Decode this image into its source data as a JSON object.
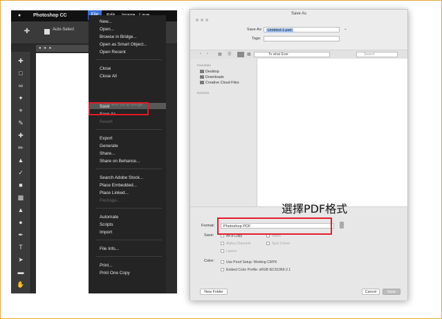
{
  "photoshop": {
    "menubar": {
      "apple": "",
      "app_name": "Photoshop CC",
      "file": "File",
      "edit": "Edit",
      "image": "Image",
      "layer": "Laye"
    },
    "options": {
      "auto_select": "Auto-Select"
    },
    "file_menu": {
      "items": [
        "New...",
        "Open...",
        "Browse in Bridge...",
        "Open as Smart Object...",
        "Open Recent",
        "Close",
        "Close All",
        "Save",
        "Save As...",
        "Revert",
        "Export",
        "Generate",
        "Share...",
        "Share on Behance...",
        "Search Adobe Stock...",
        "Place Embedded...",
        "Place Linked...",
        "Package...",
        "Automate",
        "Scripts",
        "Import",
        "File Info...",
        "Print...",
        "Print One Copy"
      ],
      "ghost": "Close and Go to Bridge..."
    }
  },
  "save_dialog": {
    "title": "Save As",
    "save_as_label": "Save As:",
    "save_as_value": "Untitled-1.psd",
    "tags_label": "Tags:",
    "location": "To what Ever",
    "search_placeholder": "Search",
    "sidebar": {
      "favorites_header": "Favorites",
      "items": [
        "Desktop",
        "Downloads",
        "Creative Cloud Files"
      ],
      "devices_header": "Devices"
    },
    "format_label": "Format:",
    "format_value": "Photoshop PDF",
    "save_label": "Save:",
    "save_options": [
      "As a Copy",
      "Notes",
      "Alpha Channels",
      "Spot Colors",
      "Layers"
    ],
    "color_label": "Color:",
    "color_options": [
      "Use Proof Setup:  Working CMYK",
      "Embed Color Profile:  sRGB IEC61966-2.1"
    ],
    "new_folder": "New Folder",
    "cancel": "Cancel",
    "save": "Save"
  },
  "annotation": {
    "text": "選擇PDF格式",
    "color": "#e21b27"
  }
}
